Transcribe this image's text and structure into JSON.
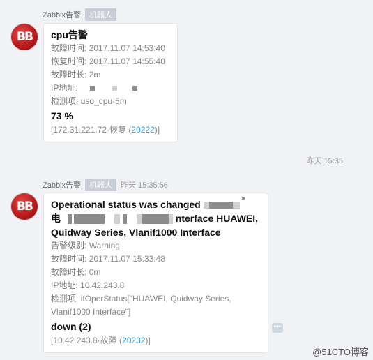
{
  "msg1": {
    "sender": "Zabbix告警",
    "badge": "机器人",
    "title": "cpu告警",
    "rows": [
      {
        "label": "故障时间:",
        "value": "2017.11.07 14:53:40"
      },
      {
        "label": "恢复时间:",
        "value": "2017.11.07 14:55:40"
      },
      {
        "label": "故障时长:",
        "value": "2m"
      },
      {
        "label": "IP地址:",
        "value": ""
      },
      {
        "label": "检测项:",
        "value": "uso_cpu-5m"
      }
    ],
    "value": "73 %",
    "footer_prefix": "[172.31.221.72·恢复 (",
    "footer_link": "20222",
    "footer_suffix": ")]"
  },
  "divider_time": "昨天 15:35",
  "msg2": {
    "sender": "Zabbix告警",
    "badge": "机器人",
    "time": "昨天 15:35:56",
    "title_line1": "Operational status was changed",
    "title_line2_prefix": "电",
    "title_line2_suffix": "nterface HUAWEI,",
    "title_line3": "Quidway Series, Vlanif1000 Interface",
    "rows": [
      {
        "label": "告警级别:",
        "value": "Warning"
      },
      {
        "label": "故障时间:",
        "value": "2017.11.07 15:33:48"
      },
      {
        "label": "故障时长:",
        "value": "0m"
      },
      {
        "label": "IP地址:",
        "value": "10.42.243.8"
      },
      {
        "label": "检测项:",
        "value": "ifOperStatus[\"HUAWEI, Quidway Series,"
      },
      {
        "label": "",
        "value": "Vlanif1000 Interface\"]"
      }
    ],
    "value": "down (2)",
    "footer_prefix": "[10.42.243.8·故障 (",
    "footer_link": "20232",
    "footer_suffix": ")]"
  },
  "watermark": "@51CTO博客"
}
